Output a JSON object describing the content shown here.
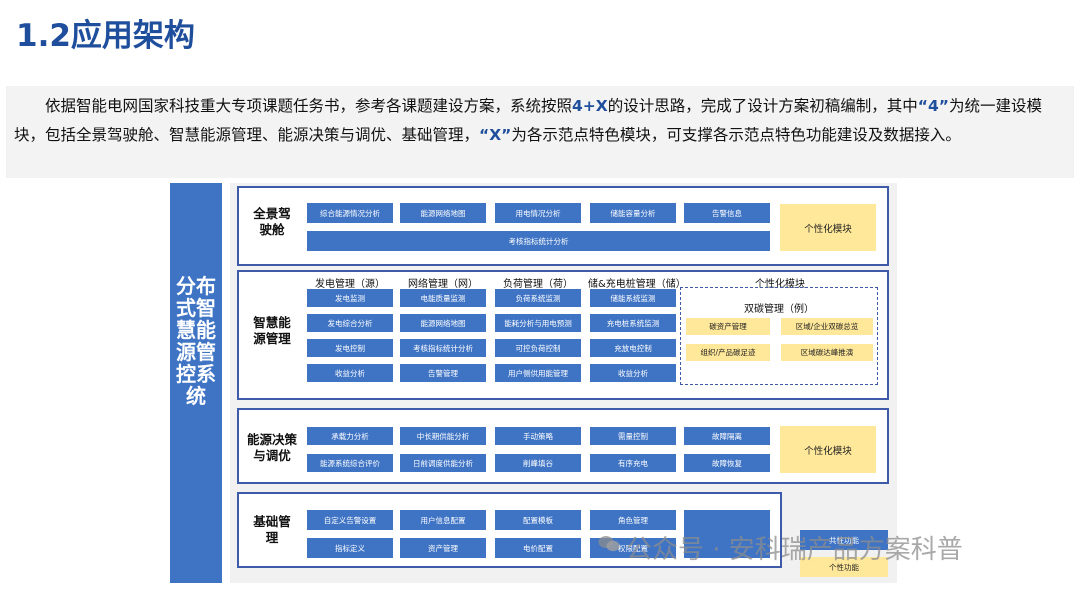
{
  "title": "1.2应用架构",
  "intro": {
    "pre1": "依据智能电网国家科技重大专项课题任务书，参考各课题建设方案，系统按照",
    "b1": "4+X",
    "mid1": "的设计思路，完成了设计方案初稿编制，其中",
    "b2": "“4”",
    "mid2": "为统一建设模块，包括全景驾驶舱、智慧能源管理、能源决策与调优、基础管理，",
    "b3": "“X”",
    "post": "为各示范点特色模块，可支撑各示范点特色功能建设及数据接入。"
  },
  "system_label": "分布式智慧能源管控系统",
  "panels": {
    "cockpit": {
      "label": "全景驾驶舱",
      "cells": [
        "综合能源情况分析",
        "能源网络地图",
        "用电情况分析",
        "储能容量分析",
        "告警信息"
      ],
      "wide": "考核指标统计分析",
      "custom": "个性化模块"
    },
    "energy": {
      "label": "智慧能源管理",
      "headers": [
        "发电管理（源）",
        "网络管理（网）",
        "负荷管理（荷）",
        "储&充电桩管理（储）",
        "个性化模块"
      ],
      "columns": [
        [
          "发电监测",
          "发电综合分析",
          "发电控制",
          "收益分析"
        ],
        [
          "电能质量监测",
          "能源网络地图",
          "考核指标统计分析",
          "告警管理"
        ],
        [
          "负荷系统监测",
          "能耗分析与用电预测",
          "可控负荷控制",
          "用户侧供用能管理"
        ],
        [
          "储能系统监测",
          "充电桩系统监测",
          "充放电控制",
          "收益分析"
        ]
      ],
      "carbon_title": "双碳管理（例）",
      "carbon": [
        "碳资产管理",
        "区域/企业双碳总览",
        "组织/产品碳足迹",
        "区域碳达峰推演"
      ]
    },
    "decision": {
      "label": "能源决策与调优",
      "row1": [
        "承载力分析",
        "中长期供能分析",
        "手动策略",
        "需量控制",
        "故障隔离"
      ],
      "row2": [
        "能源系统综合评价",
        "日前调度供能分析",
        "削峰填谷",
        "有序充电",
        "故障恢复"
      ],
      "custom": "个性化模块"
    },
    "basic": {
      "label": "基础管理",
      "row1": [
        "自定义告警设置",
        "用户信息配置",
        "配置模板",
        "角色管理"
      ],
      "row2": [
        "指标定义",
        "资产管理",
        "电价配置",
        "权限配置"
      ],
      "extra_top": "共性功能",
      "extra_bottom": "个性功能"
    }
  },
  "watermark": "公众号 · 安科瑞产品方案科普",
  "colors": {
    "primary": "#3f74c5",
    "border": "#3f5aa8",
    "title": "#1f4e9c",
    "highlight": "#ffe89a"
  }
}
